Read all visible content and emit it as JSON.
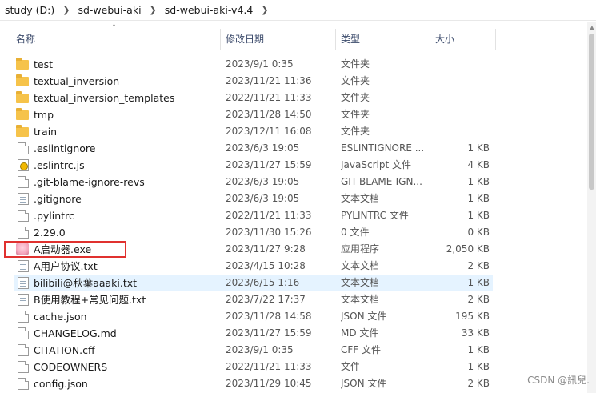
{
  "breadcrumb": [
    "study (D:)",
    "sd-webui-aki",
    "sd-webui-aki-v4.4"
  ],
  "columns": {
    "name": "名称",
    "date": "修改日期",
    "type": "类型",
    "size": "大小"
  },
  "rows": [
    {
      "icon": "folder-icon",
      "name": "test",
      "date": "2023/9/1 0:35",
      "type": "文件夹",
      "size": ""
    },
    {
      "icon": "folder-icon",
      "name": "textual_inversion",
      "date": "2023/11/21 11:36",
      "type": "文件夹",
      "size": ""
    },
    {
      "icon": "folder-icon",
      "name": "textual_inversion_templates",
      "date": "2022/11/21 11:33",
      "type": "文件夹",
      "size": ""
    },
    {
      "icon": "folder-icon",
      "name": "tmp",
      "date": "2023/11/28 14:50",
      "type": "文件夹",
      "size": ""
    },
    {
      "icon": "folder-icon",
      "name": "train",
      "date": "2023/12/11 16:08",
      "type": "文件夹",
      "size": ""
    },
    {
      "icon": "file-icon",
      "name": ".eslintignore",
      "date": "2023/6/3 19:05",
      "type": "ESLINTIGNORE ...",
      "size": "1 KB"
    },
    {
      "icon": "js-icon",
      "name": ".eslintrc.js",
      "date": "2023/11/27 15:59",
      "type": "JavaScript 文件",
      "size": "4 KB"
    },
    {
      "icon": "file-icon",
      "name": ".git-blame-ignore-revs",
      "date": "2023/6/3 19:05",
      "type": "GIT-BLAME-IGN...",
      "size": "1 KB"
    },
    {
      "icon": "text-icon",
      "name": ".gitignore",
      "date": "2023/6/3 19:05",
      "type": "文本文档",
      "size": "1 KB"
    },
    {
      "icon": "file-icon",
      "name": ".pylintrc",
      "date": "2022/11/21 11:33",
      "type": "PYLINTRC 文件",
      "size": "1 KB"
    },
    {
      "icon": "file-icon",
      "name": "2.29.0",
      "date": "2023/11/30 15:26",
      "type": "0 文件",
      "size": "0 KB"
    },
    {
      "icon": "exe-icon",
      "name": "A启动器.exe",
      "date": "2023/11/27 9:28",
      "type": "应用程序",
      "size": "2,050 KB"
    },
    {
      "icon": "text-icon",
      "name": "A用户协议.txt",
      "date": "2023/4/15 10:28",
      "type": "文本文档",
      "size": "2 KB"
    },
    {
      "icon": "text-icon",
      "name": "bilibili@秋葉aaaki.txt",
      "date": "2023/6/15 1:16",
      "type": "文本文档",
      "size": "1 KB",
      "hover": true
    },
    {
      "icon": "text-icon",
      "name": "B使用教程+常见问题.txt",
      "date": "2023/7/22 17:37",
      "type": "文本文档",
      "size": "2 KB"
    },
    {
      "icon": "file-icon",
      "name": "cache.json",
      "date": "2023/11/28 14:58",
      "type": "JSON 文件",
      "size": "195 KB"
    },
    {
      "icon": "file-icon",
      "name": "CHANGELOG.md",
      "date": "2023/11/27 15:59",
      "type": "MD 文件",
      "size": "33 KB"
    },
    {
      "icon": "file-icon",
      "name": "CITATION.cff",
      "date": "2023/9/1 0:35",
      "type": "CFF 文件",
      "size": "1 KB"
    },
    {
      "icon": "file-icon",
      "name": "CODEOWNERS",
      "date": "2022/11/21 11:33",
      "type": "文件",
      "size": "1 KB"
    },
    {
      "icon": "file-icon",
      "name": "config.json",
      "date": "2023/11/29 10:45",
      "type": "JSON 文件",
      "size": "2 KB"
    }
  ],
  "watermark": "CSDN @訊兒."
}
